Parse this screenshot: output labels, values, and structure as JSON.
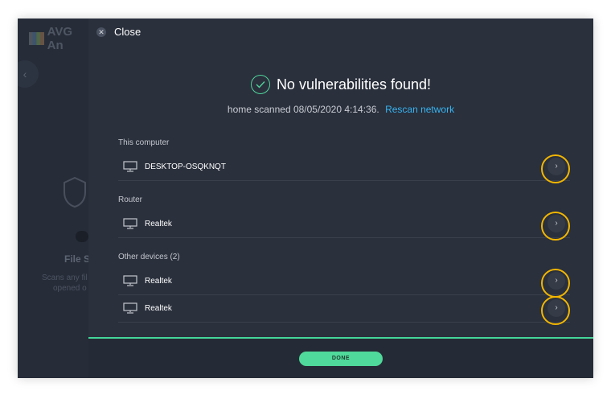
{
  "background_app": {
    "logo_text": "AVG An",
    "feature_title": "File S",
    "feature_desc_line1": "Scans any fil",
    "feature_desc_line2": "opened o"
  },
  "dialog": {
    "close_label": "Close",
    "status_title": "No vulnerabilities found!",
    "scan_text": "home scanned 08/05/2020 4:14:36.",
    "rescan_link": "Rescan network",
    "sections": [
      {
        "label": "This computer",
        "devices": [
          "DESKTOP-OSQKNQT"
        ]
      },
      {
        "label": "Router",
        "devices": [
          "Realtek"
        ]
      },
      {
        "label": "Other devices (2)",
        "devices": [
          "Realtek",
          "Realtek"
        ]
      }
    ],
    "done_label": "DONE"
  },
  "icons": {
    "close": "close-icon",
    "check": "check-circle-icon",
    "device": "monitor-icon",
    "details": "chevron-right-icon",
    "chevron_glyph": "›",
    "back_glyph": "‹",
    "close_glyph": "✕"
  },
  "colors": {
    "panel_bg": "#2a303c",
    "accent_green": "#4fd99a",
    "link_blue": "#37b3f0",
    "highlight_ring": "#f2b600"
  }
}
